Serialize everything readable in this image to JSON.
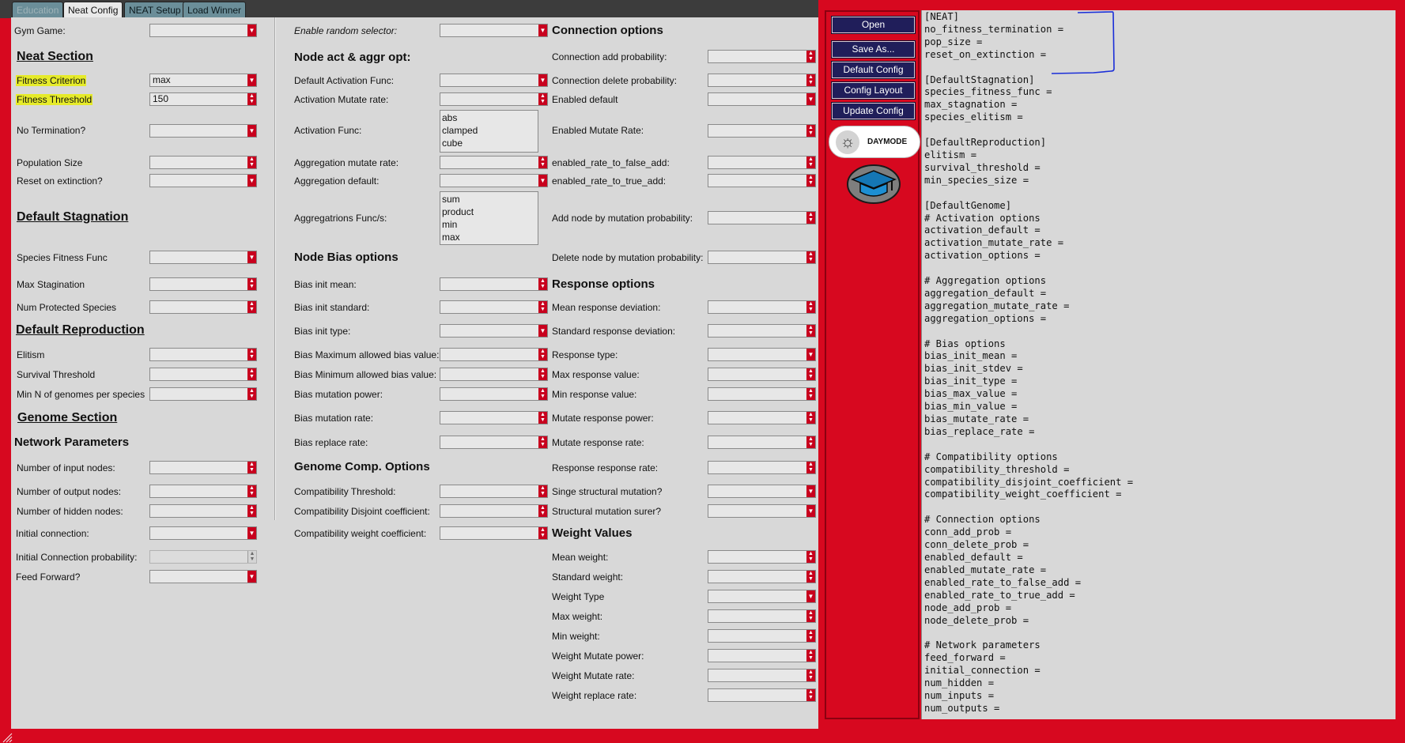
{
  "tabs": [
    {
      "label": "Education"
    },
    {
      "label": "Neat Config"
    },
    {
      "label": "NEAT Setup"
    },
    {
      "label": "Load Winner"
    }
  ],
  "col1": {
    "gym_game": {
      "label": "Gym Game:",
      "value": ""
    },
    "neat_section": "Neat Section",
    "fitness_criterion": {
      "label": "Fitness Criterion",
      "value": "max"
    },
    "fitness_threshold": {
      "label": "Fitness Threshold",
      "value": "150"
    },
    "no_termination": {
      "label": "No Termination?",
      "value": ""
    },
    "population_size": {
      "label": "Population Size",
      "value": ""
    },
    "reset_on_extinction": {
      "label": "Reset on extinction?",
      "value": ""
    },
    "default_stagnation": "Default Stagnation",
    "species_fitness_func": {
      "label": "Species Fitness Func",
      "value": ""
    },
    "max_stagination": {
      "label": "Max Stagination",
      "value": ""
    },
    "num_protected_species": {
      "label": "Num Protected Species",
      "value": ""
    },
    "default_reproduction": "Default Reproduction",
    "elitism": {
      "label": "Elitism",
      "value": ""
    },
    "survival_threshold": {
      "label": "Survival Threshold",
      "value": ""
    },
    "min_genomes": {
      "label": "Min N of genomes per species",
      "value": ""
    },
    "genome_section": "Genome Section",
    "network_parameters": "Network Parameters",
    "num_input": {
      "label": "Number of input nodes:",
      "value": ""
    },
    "num_output": {
      "label": "Number of output nodes:",
      "value": ""
    },
    "num_hidden": {
      "label": "Number of hidden nodes:",
      "value": ""
    },
    "initial_connection": {
      "label": "Initial connection:",
      "value": ""
    },
    "initial_connection_prob": {
      "label": "Initial Connection probability:",
      "value": ""
    },
    "feed_forward": {
      "label": "Feed Forward?",
      "value": ""
    }
  },
  "col2": {
    "enable_random": {
      "label": "Enable random selector:",
      "value": ""
    },
    "node_act_header": "Node act & aggr opt:",
    "default_activation": {
      "label": "Default Activation Func:",
      "value": ""
    },
    "activation_mutate": {
      "label": "Activation Mutate rate:",
      "value": ""
    },
    "activation_func": {
      "label": "Activation Func:",
      "options": [
        "abs",
        "clamped",
        "cube"
      ]
    },
    "aggregation_mutate": {
      "label": "Aggregation mutate rate:",
      "value": ""
    },
    "aggregation_default": {
      "label": "Aggregation default:",
      "value": ""
    },
    "aggregation_funcs": {
      "label": "Aggregatrions Func/s:",
      "options": [
        "sum",
        "product",
        "min",
        "max"
      ]
    },
    "node_bias_header": "Node Bias options",
    "bias_init_mean": {
      "label": "Bias init mean:",
      "value": ""
    },
    "bias_init_standard": {
      "label": "Bias init standard:",
      "value": ""
    },
    "bias_init_type": {
      "label": "Bias init type:",
      "value": ""
    },
    "bias_max": {
      "label": "Bias Maximum allowed bias value:",
      "value": ""
    },
    "bias_min": {
      "label": "Bias Minimum allowed bias value:",
      "value": ""
    },
    "bias_mutation_power": {
      "label": "Bias mutation power:",
      "value": ""
    },
    "bias_mutation_rate": {
      "label": "Bias mutation rate:",
      "value": ""
    },
    "bias_replace_rate": {
      "label": "Bias replace rate:",
      "value": ""
    },
    "genome_comp_header": "Genome Comp. Options",
    "compat_threshold": {
      "label": "Compatibility Threshold:",
      "value": ""
    },
    "compat_disjoint": {
      "label": "Compatibility Disjoint coefficient:",
      "value": ""
    },
    "compat_weight": {
      "label": "Compatibility weight coefficient:",
      "value": ""
    }
  },
  "col3": {
    "connection_header": "Connection options",
    "conn_add": {
      "label": "Connection add probability:",
      "value": ""
    },
    "conn_delete": {
      "label": "Connection delete probability:",
      "value": ""
    },
    "enabled_default": {
      "label": "Enabled default",
      "value": ""
    },
    "enabled_mutate": {
      "label": "Enabled Mutate Rate:",
      "value": ""
    },
    "rate_false": {
      "label": "enabled_rate_to_false_add:",
      "value": ""
    },
    "rate_true": {
      "label": "enabled_rate_to_true_add:",
      "value": ""
    },
    "add_node": {
      "label": "Add node by mutation probability:",
      "value": ""
    },
    "delete_node": {
      "label": "Delete node by mutation probability:",
      "value": ""
    },
    "response_header": "Response options",
    "mean_response_dev": {
      "label": "Mean response deviation:",
      "value": ""
    },
    "std_response_dev": {
      "label": "Standard response deviation:",
      "value": ""
    },
    "response_type": {
      "label": "Response type:",
      "value": ""
    },
    "max_response": {
      "label": "Max response value:",
      "value": ""
    },
    "min_response": {
      "label": "Min response value:",
      "value": ""
    },
    "mutate_response_power": {
      "label": "Mutate response power:",
      "value": ""
    },
    "mutate_response_rate": {
      "label": "Mutate response rate:",
      "value": ""
    },
    "response_response_rate": {
      "label": "Response response rate:",
      "value": ""
    },
    "singe_structural": {
      "label": "Singe structural mutation?",
      "value": ""
    },
    "structural_surer": {
      "label": "Structural mutation surer?",
      "value": ""
    },
    "weight_header": "Weight Values",
    "mean_weight": {
      "label": "Mean weight:",
      "value": ""
    },
    "standard_weight": {
      "label": "Standard weight:",
      "value": ""
    },
    "weight_type": {
      "label": "Weight Type",
      "value": ""
    },
    "max_weight": {
      "label": "Max weight:",
      "value": ""
    },
    "min_weight": {
      "label": "Min weight:",
      "value": ""
    },
    "weight_mutate_power": {
      "label": "Weight Mutate power:",
      "value": ""
    },
    "weight_mutate_rate": {
      "label": "Weight Mutate rate:",
      "value": ""
    },
    "weight_replace_rate": {
      "label": "Weight replace rate:",
      "value": ""
    }
  },
  "sidebar": {
    "open": "Open",
    "save_as": "Save As...",
    "default_config": "Default Config",
    "config_layout": "Config Layout",
    "update_config": "Update Config",
    "daymode": "DAYMODE",
    "sun_icon": "☼"
  },
  "config_text": "[NEAT]\nno_fitness_termination =\npop_size =\nreset_on_extinction =\n\n[DefaultStagnation]\nspecies_fitness_func =\nmax_stagnation =\nspecies_elitism =\n\n[DefaultReproduction]\nelitism =\nsurvival_threshold =\nmin_species_size =\n\n[DefaultGenome]\n# Activation options\nactivation_default =\nactivation_mutate_rate =\nactivation_options =\n\n# Aggregation options\naggregation_default =\naggregation_mutate_rate =\naggregation_options =\n\n# Bias options\nbias_init_mean =\nbias_init_stdev =\nbias_init_type =\nbias_max_value =\nbias_min_value =\nbias_mutate_rate =\nbias_replace_rate =\n\n# Compatibility options\ncompatibility_threshold =\ncompatibility_disjoint_coefficient =\ncompatibility_weight_coefficient =\n\n# Connection options\nconn_add_prob =\nconn_delete_prob =\nenabled_default =\nenabled_mutate_rate =\nenabled_rate_to_false_add =\nenabled_rate_to_true_add =\nnode_add_prob =\nnode_delete_prob =\n\n# Network parameters\nfeed_forward =\ninitial_connection =\nnum_hidden =\nnum_inputs =\nnum_outputs =",
  "colors": {
    "frame": "#d7081f",
    "panel": "#d8d8d8",
    "button": "#201e5a",
    "highlight": "#e6eb2a",
    "annotation": "#1a2ed8"
  }
}
